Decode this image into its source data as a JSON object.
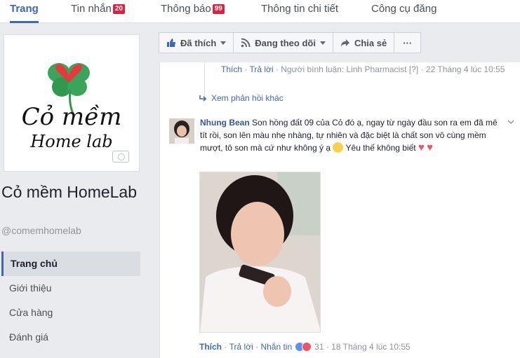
{
  "tabs": [
    {
      "label": "Trang",
      "badge": ""
    },
    {
      "label": "Tin nhắn",
      "badge": "20"
    },
    {
      "label": "Thông báo",
      "badge": "99"
    },
    {
      "label": "Thông tin chi tiết",
      "badge": ""
    },
    {
      "label": "Công cụ đăng",
      "badge": ""
    }
  ],
  "page": {
    "logo_title": "Cỏ mềm",
    "logo_subtitle": "Home lab",
    "name": "Cỏ mềm HomeLab",
    "handle": "@comemhomelab"
  },
  "nav": [
    {
      "label": "Trang chủ"
    },
    {
      "label": "Giới thiệu"
    },
    {
      "label": "Cửa hàng"
    },
    {
      "label": "Đánh giá"
    }
  ],
  "actionbar": {
    "like": "Đã thích",
    "follow": "Đang theo dõi",
    "share": "Chia sẻ",
    "more": "···"
  },
  "prev_reply": {
    "like": "Thích",
    "reply": "Trả lời",
    "commenter": "Người bình luận: Linh Pharmacist",
    "help": "[?]",
    "time": "22 Tháng 4 lúc 10:55",
    "more_replies": "Xem phản hồi khác"
  },
  "comment": {
    "author": "Nhung Bean",
    "text": "Son hồng đất 09 của Cỏ đó ạ, ngay từ ngày đầu son ra em đã mê tít rồi, son lên màu nhẹ nhàng, tự nhiên và đặc biệt là chất son vô cùng mềm mượt, tô son mà cứ như không ý ạ",
    "text_end": "Yêu thế không biết",
    "like": "Thích",
    "reply": "Trả lời",
    "message": "Nhắn tin",
    "reaction_count": "31",
    "time": "18 Tháng 4 lúc 10:55"
  },
  "colors": {
    "accent": "#4267b2",
    "badge": "#e41e3f",
    "heart": "#f25268"
  }
}
